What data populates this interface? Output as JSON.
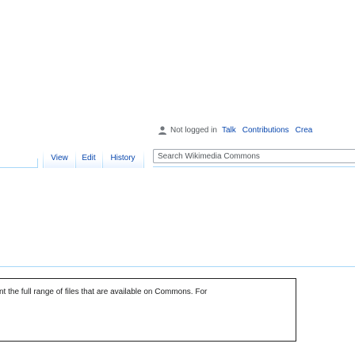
{
  "personal_tools": {
    "anon_text": "Not logged in",
    "links": [
      "Talk",
      "Contributions",
      "Crea"
    ]
  },
  "tabs": {
    "view": "View",
    "edit": "Edit",
    "history": "History"
  },
  "search": {
    "placeholder": "Search Wikimedia Commons"
  },
  "notice": {
    "text": "nt the full range of files that are available on Commons. For"
  },
  "colors": {
    "link": "#0645ad",
    "tab_border": "#a7d7f9",
    "search_border": "#a2a9b1"
  }
}
